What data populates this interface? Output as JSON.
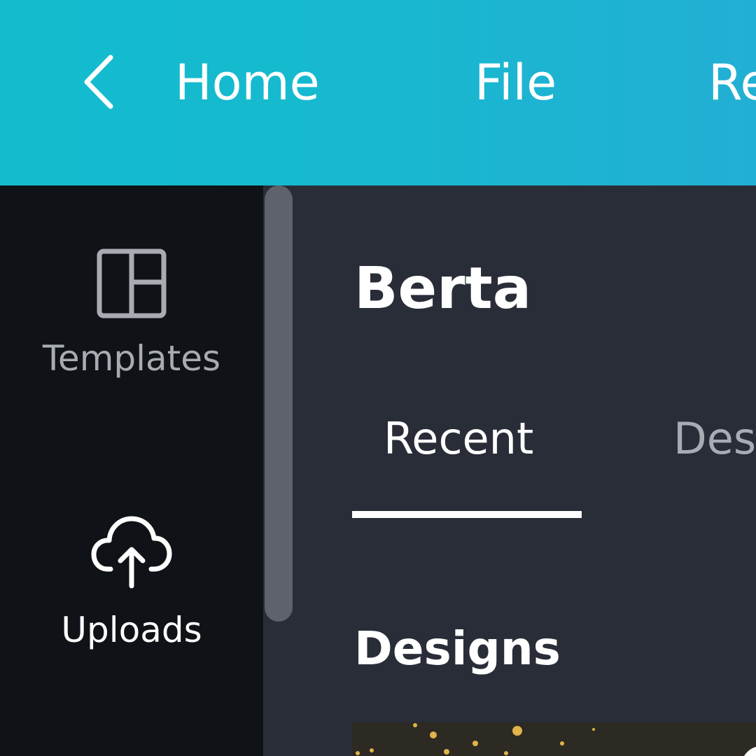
{
  "topbar": {
    "nav_items": [
      {
        "label": "Home"
      },
      {
        "label": "File"
      },
      {
        "label": "Re"
      }
    ]
  },
  "sidebar": {
    "items": [
      {
        "label": "Templates",
        "icon": "templates-icon"
      },
      {
        "label": "Uploads",
        "icon": "upload-cloud-icon"
      }
    ]
  },
  "panel": {
    "title": "Berta",
    "tabs": [
      {
        "label": "Recent",
        "active": true
      },
      {
        "label": "Des",
        "active": false
      }
    ],
    "section_title": "Designs"
  },
  "colors": {
    "topbar_start": "#12bccd",
    "topbar_end": "#22afd4",
    "sidebar_bg": "#0f1216",
    "panel_bg": "#292d38",
    "scrollbar": "#5d626b",
    "muted_text": "#a8acb2",
    "thumb_dots": "#e0b44a"
  }
}
